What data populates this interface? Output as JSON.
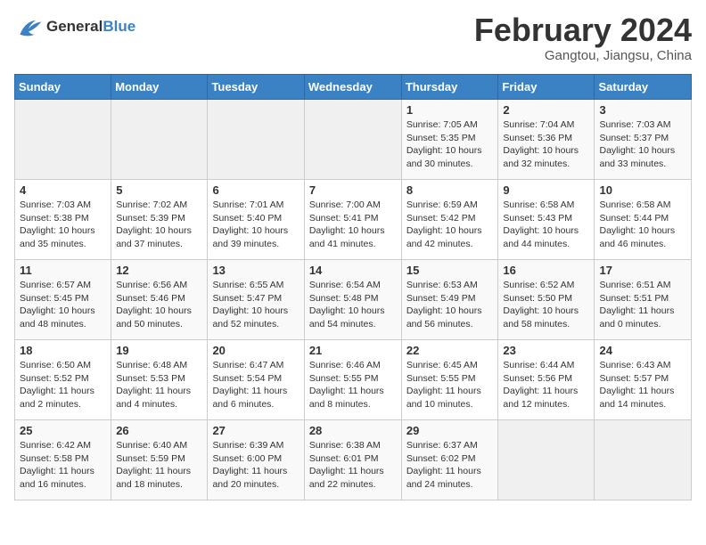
{
  "header": {
    "logo_line1": "General",
    "logo_line2": "Blue",
    "month_title": "February 2024",
    "location": "Gangtou, Jiangsu, China"
  },
  "weekdays": [
    "Sunday",
    "Monday",
    "Tuesday",
    "Wednesday",
    "Thursday",
    "Friday",
    "Saturday"
  ],
  "weeks": [
    [
      {
        "day": "",
        "info": ""
      },
      {
        "day": "",
        "info": ""
      },
      {
        "day": "",
        "info": ""
      },
      {
        "day": "",
        "info": ""
      },
      {
        "day": "1",
        "info": "Sunrise: 7:05 AM\nSunset: 5:35 PM\nDaylight: 10 hours\nand 30 minutes."
      },
      {
        "day": "2",
        "info": "Sunrise: 7:04 AM\nSunset: 5:36 PM\nDaylight: 10 hours\nand 32 minutes."
      },
      {
        "day": "3",
        "info": "Sunrise: 7:03 AM\nSunset: 5:37 PM\nDaylight: 10 hours\nand 33 minutes."
      }
    ],
    [
      {
        "day": "4",
        "info": "Sunrise: 7:03 AM\nSunset: 5:38 PM\nDaylight: 10 hours\nand 35 minutes."
      },
      {
        "day": "5",
        "info": "Sunrise: 7:02 AM\nSunset: 5:39 PM\nDaylight: 10 hours\nand 37 minutes."
      },
      {
        "day": "6",
        "info": "Sunrise: 7:01 AM\nSunset: 5:40 PM\nDaylight: 10 hours\nand 39 minutes."
      },
      {
        "day": "7",
        "info": "Sunrise: 7:00 AM\nSunset: 5:41 PM\nDaylight: 10 hours\nand 41 minutes."
      },
      {
        "day": "8",
        "info": "Sunrise: 6:59 AM\nSunset: 5:42 PM\nDaylight: 10 hours\nand 42 minutes."
      },
      {
        "day": "9",
        "info": "Sunrise: 6:58 AM\nSunset: 5:43 PM\nDaylight: 10 hours\nand 44 minutes."
      },
      {
        "day": "10",
        "info": "Sunrise: 6:58 AM\nSunset: 5:44 PM\nDaylight: 10 hours\nand 46 minutes."
      }
    ],
    [
      {
        "day": "11",
        "info": "Sunrise: 6:57 AM\nSunset: 5:45 PM\nDaylight: 10 hours\nand 48 minutes."
      },
      {
        "day": "12",
        "info": "Sunrise: 6:56 AM\nSunset: 5:46 PM\nDaylight: 10 hours\nand 50 minutes."
      },
      {
        "day": "13",
        "info": "Sunrise: 6:55 AM\nSunset: 5:47 PM\nDaylight: 10 hours\nand 52 minutes."
      },
      {
        "day": "14",
        "info": "Sunrise: 6:54 AM\nSunset: 5:48 PM\nDaylight: 10 hours\nand 54 minutes."
      },
      {
        "day": "15",
        "info": "Sunrise: 6:53 AM\nSunset: 5:49 PM\nDaylight: 10 hours\nand 56 minutes."
      },
      {
        "day": "16",
        "info": "Sunrise: 6:52 AM\nSunset: 5:50 PM\nDaylight: 10 hours\nand 58 minutes."
      },
      {
        "day": "17",
        "info": "Sunrise: 6:51 AM\nSunset: 5:51 PM\nDaylight: 11 hours\nand 0 minutes."
      }
    ],
    [
      {
        "day": "18",
        "info": "Sunrise: 6:50 AM\nSunset: 5:52 PM\nDaylight: 11 hours\nand 2 minutes."
      },
      {
        "day": "19",
        "info": "Sunrise: 6:48 AM\nSunset: 5:53 PM\nDaylight: 11 hours\nand 4 minutes."
      },
      {
        "day": "20",
        "info": "Sunrise: 6:47 AM\nSunset: 5:54 PM\nDaylight: 11 hours\nand 6 minutes."
      },
      {
        "day": "21",
        "info": "Sunrise: 6:46 AM\nSunset: 5:55 PM\nDaylight: 11 hours\nand 8 minutes."
      },
      {
        "day": "22",
        "info": "Sunrise: 6:45 AM\nSunset: 5:55 PM\nDaylight: 11 hours\nand 10 minutes."
      },
      {
        "day": "23",
        "info": "Sunrise: 6:44 AM\nSunset: 5:56 PM\nDaylight: 11 hours\nand 12 minutes."
      },
      {
        "day": "24",
        "info": "Sunrise: 6:43 AM\nSunset: 5:57 PM\nDaylight: 11 hours\nand 14 minutes."
      }
    ],
    [
      {
        "day": "25",
        "info": "Sunrise: 6:42 AM\nSunset: 5:58 PM\nDaylight: 11 hours\nand 16 minutes."
      },
      {
        "day": "26",
        "info": "Sunrise: 6:40 AM\nSunset: 5:59 PM\nDaylight: 11 hours\nand 18 minutes."
      },
      {
        "day": "27",
        "info": "Sunrise: 6:39 AM\nSunset: 6:00 PM\nDaylight: 11 hours\nand 20 minutes."
      },
      {
        "day": "28",
        "info": "Sunrise: 6:38 AM\nSunset: 6:01 PM\nDaylight: 11 hours\nand 22 minutes."
      },
      {
        "day": "29",
        "info": "Sunrise: 6:37 AM\nSunset: 6:02 PM\nDaylight: 11 hours\nand 24 minutes."
      },
      {
        "day": "",
        "info": ""
      },
      {
        "day": "",
        "info": ""
      }
    ]
  ]
}
